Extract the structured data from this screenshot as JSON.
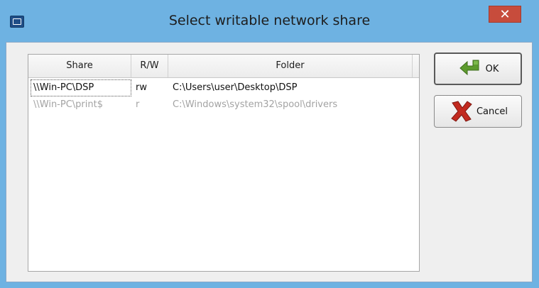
{
  "window": {
    "title": "Select writable network share",
    "close_label": "✕"
  },
  "table": {
    "columns": [
      "Share",
      "R/W",
      "Folder"
    ],
    "rows": [
      {
        "share": "\\\\Win-PC\\DSP",
        "rw": "rw",
        "folder": "C:\\Users\\user\\Desktop\\DSP",
        "enabled": true
      },
      {
        "share": "\\\\Win-PC\\print$",
        "rw": "r",
        "folder": "C:\\Windows\\system32\\spool\\drivers",
        "enabled": false
      }
    ]
  },
  "buttons": {
    "ok_label": "OK",
    "cancel_label": "Cancel"
  },
  "icons": {
    "app": "app-icon",
    "ok": "green-return-arrow-icon",
    "cancel": "red-x-icon"
  },
  "colors": {
    "titlebar": "#6eb2e2",
    "close": "#c74c3c",
    "ok_icon": "#5d9b2e",
    "cancel_icon": "#c22a1f",
    "disabled_text": "#a3a3a3"
  }
}
